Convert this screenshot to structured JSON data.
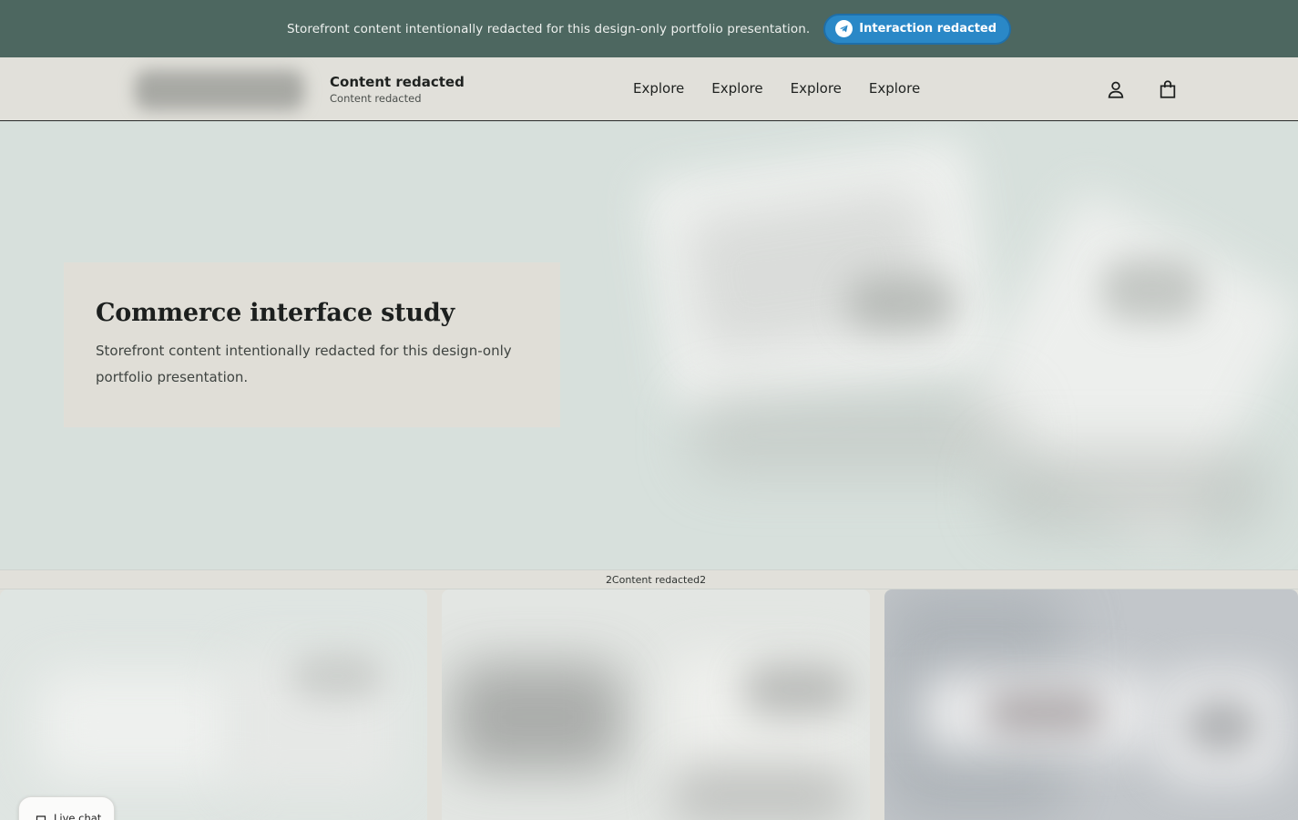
{
  "announcement": {
    "text": "Storefront content intentionally redacted for this design-only portfolio presentation.",
    "button_label": "Interaction redacted",
    "button_icon": "telegram-icon",
    "bg_color": "#4d6760",
    "button_color": "#2a88c7"
  },
  "header": {
    "logo": "blurred-logo",
    "brand_title": "Content redacted",
    "brand_subtitle": "Content redacted",
    "nav": [
      {
        "label": "Explore"
      },
      {
        "label": "Explore"
      },
      {
        "label": "Explore"
      },
      {
        "label": "Explore"
      }
    ],
    "icons": [
      "account-icon",
      "shopping-bag-icon"
    ]
  },
  "hero": {
    "title": "Commerce interface study",
    "text": "Storefront content intentionally redacted for this design-only portfolio presentation.",
    "bg_color": "#d7e0dc"
  },
  "strip": {
    "text": "2Content redacted2"
  },
  "products": [
    {
      "image": "blurred-product-image"
    },
    {
      "image": "blurred-product-image"
    },
    {
      "image": "blurred-product-image"
    }
  ],
  "chat": {
    "label": "Live chat",
    "icon": "chat-bubble-icon"
  }
}
